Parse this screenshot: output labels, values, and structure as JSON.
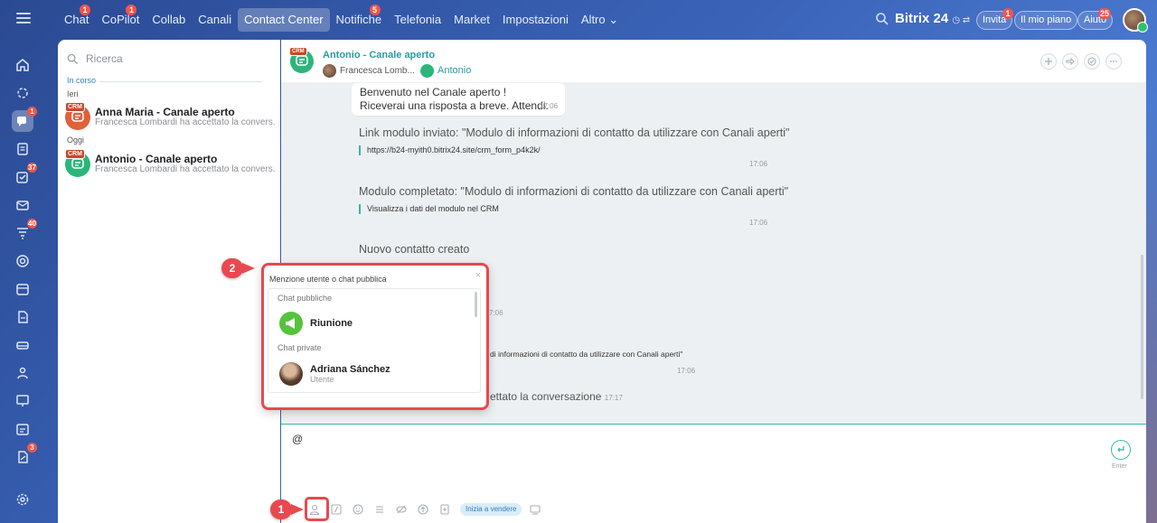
{
  "topbar": {
    "nav": [
      {
        "label": "Chat",
        "badge": "1"
      },
      {
        "label": "CoPilot",
        "badge": "1"
      },
      {
        "label": "Collab",
        "badge": ""
      },
      {
        "label": "Canali",
        "badge": ""
      },
      {
        "label": "Contact Center",
        "badge": ""
      },
      {
        "label": "Notifiche",
        "badge": "5"
      },
      {
        "label": "Telefonia",
        "badge": ""
      },
      {
        "label": "Market",
        "badge": ""
      },
      {
        "label": "Impostazioni",
        "badge": ""
      },
      {
        "label": "Altro ⌄",
        "badge": ""
      }
    ],
    "logo": "Bitrix 24",
    "logo_suffix": "◷ ⇄",
    "invite_label": "Invita",
    "invite_badge": "1",
    "plan_label": "Il mio piano",
    "help_label": "Aiuto",
    "help_badge": "25"
  },
  "rail": {
    "badges": {
      "chat": "1",
      "tasks": "37",
      "feed": "40",
      "sign": "3"
    }
  },
  "chatlist": {
    "search_placeholder": "Ricerca",
    "section_label": "In corso",
    "day1": "Ieri",
    "day2": "Oggi",
    "crm_tag": "CRM",
    "items": [
      {
        "title": "Anna Maria - Canale aperto",
        "subtitle": "Francesca Lombardi ha accettato la convers..."
      },
      {
        "title": "Antonio - Canale aperto",
        "subtitle": "Francesca Lombardi ha accettato la convers..."
      }
    ]
  },
  "chat": {
    "title": "Antonio - Canale aperto",
    "crm_tag": "CRM",
    "member1": "Francesca Lomb...",
    "member2": "Antonio",
    "welcome_line1": "Benvenuto nel Canale aperto !",
    "welcome_line2": "Riceverai una risposta a breve. Attendi.",
    "welcome_time": "17:06",
    "msg1_title": "Link modulo inviato: \"Modulo di informazioni di contatto da utilizzare con Canali aperti\"",
    "msg1_link": "https://b24-myith0.bitrix24.site/crm_form_p4k2k/",
    "msg1_time": "17:06",
    "msg2_title": "Modulo completato: \"Modulo di informazioni di contatto da utilizzare con Canali aperti\"",
    "msg2_link": "Visualizza i dati del modulo nel CRM",
    "msg2_time": "17:06",
    "msg3_title": "Nuovo contatto creato",
    "msg3_time": "7:06",
    "msg4_text": "di informazioni di contatto da utilizzare con Canali aperti\"",
    "msg4_time": "17:06",
    "msg5_text": "ettato la conversazione",
    "msg5_time": "17:17",
    "input_value": "@",
    "enter_label": "Enter",
    "sell_label": "Inizia a vendere"
  },
  "popup": {
    "title": "Menzione utente o chat pubblica",
    "close": "×",
    "public_label": "Chat pubbliche",
    "public_item": "Riunione",
    "private_label": "Chat private",
    "private_item": "Adriana Sánchez",
    "private_item_sub": "Utente"
  },
  "steps": {
    "step1": "1",
    "step2": "2"
  },
  "colors": {
    "accent": "#39b5a8",
    "annotation": "#e8494f",
    "badge": "#f5534a",
    "crm": "#c8482a"
  }
}
